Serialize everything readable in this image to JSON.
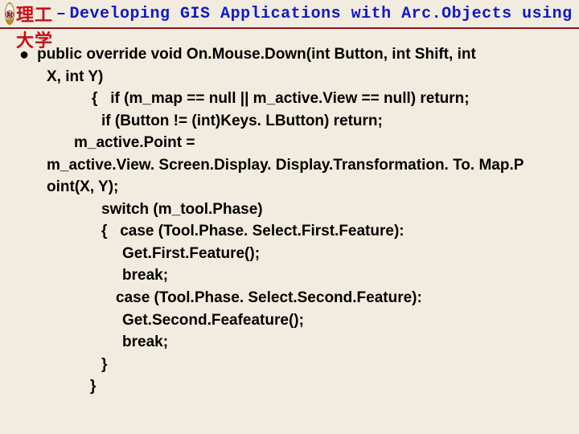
{
  "header": {
    "logo_text": "㊖",
    "title_cn": "〔西理工大学",
    "title_sep": " – ",
    "title_en": "Developing GIS Applications with Arc.Objects using C#. NE"
  },
  "code": {
    "sig1": "public override void On.Mouse.Down(int Button, int Shift, int",
    "sig2": "X, int Y)",
    "l1": "{   if (m_map == null || m_active.View == null) return;",
    "l1b": "if (Button != (int)Keys. LButton) return;",
    "l2a": "m_active.Point =",
    "l2b": "m_active.View. Screen.Display. Display.Transformation. To. Map.P\noint(X, Y);",
    "l3": "switch (m_tool.Phase)",
    "l4": "{   case (Tool.Phase. Select.First.Feature):",
    "l5a": "Get.First.Feature();",
    "l5b": "break;",
    "l5c": "case (Tool.Phase. Select.Second.Feature):",
    "l5d": "Get.Second.Feafeature();",
    "l5e": "break;",
    "l6": "}",
    "l7": "}"
  }
}
